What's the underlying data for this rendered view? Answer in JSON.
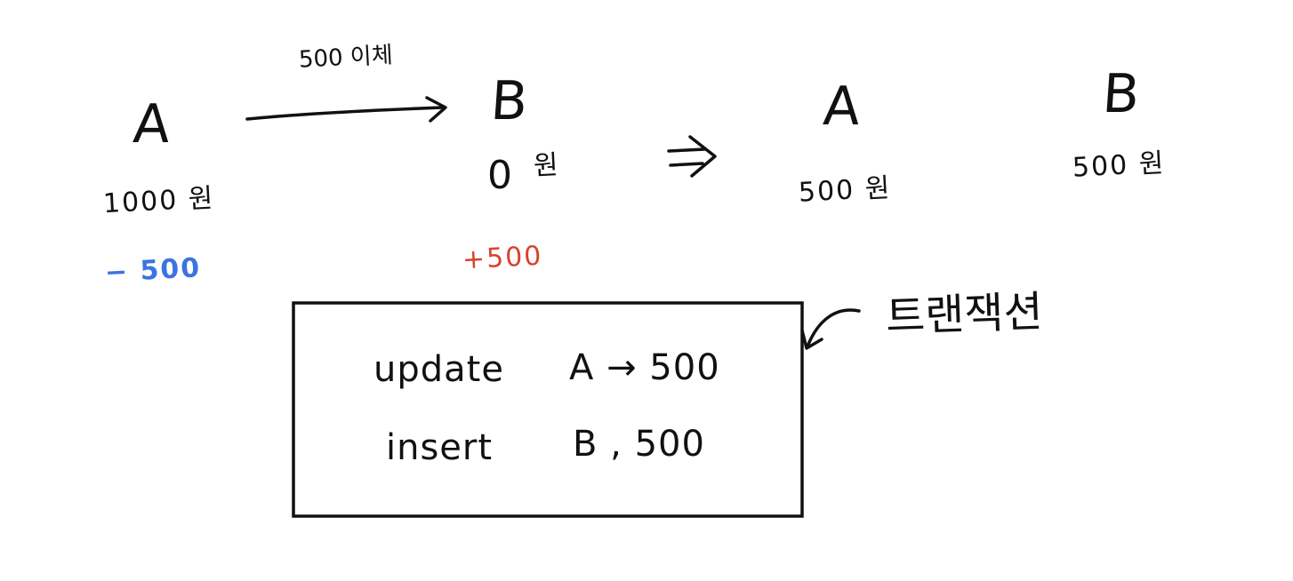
{
  "diagram": {
    "transfer_label": "500 이체",
    "before": {
      "a_label": "A",
      "a_amount": "1000 원",
      "a_change": "− 500",
      "b_label": "B",
      "b_amount_value": "0",
      "b_amount_unit": "원",
      "b_change": "+500"
    },
    "implies": "⇒",
    "after": {
      "a_label": "A",
      "a_amount": "500 원",
      "b_label": "B",
      "b_amount": "500 원"
    },
    "transaction_label": "트랜잭션",
    "transaction_box": {
      "line1_cmd": "update",
      "line1_target": "A → 500",
      "line2_cmd": "insert",
      "line2_target": "B , 500"
    }
  },
  "colors": {
    "ink": "#111111",
    "decrease": "#3b74e0",
    "increase": "#d9412f"
  }
}
